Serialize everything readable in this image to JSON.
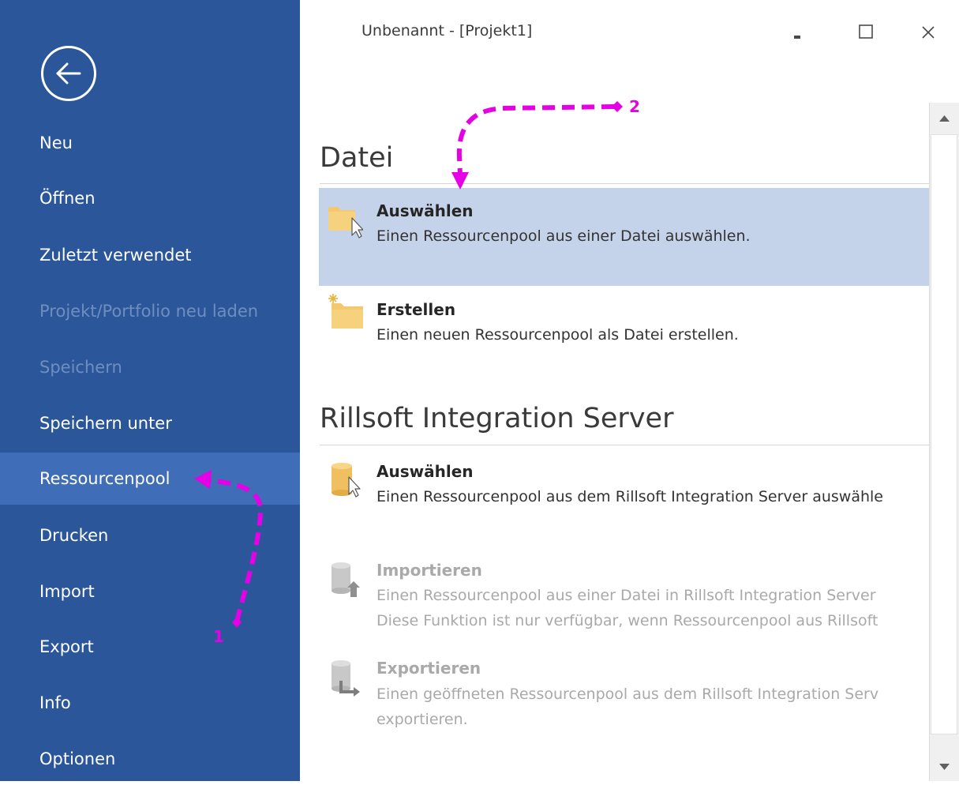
{
  "window": {
    "title": "Unbenannt - [Projekt1]",
    "controls": [
      "minimize",
      "maximize",
      "close"
    ]
  },
  "sidebar": {
    "back_icon": "back-arrow-icon",
    "items": [
      {
        "label": "Neu",
        "state": "enabled"
      },
      {
        "label": "Öffnen",
        "state": "enabled"
      },
      {
        "label": "Zuletzt verwendet",
        "state": "enabled"
      },
      {
        "label": "Projekt/Portfolio neu laden",
        "state": "disabled"
      },
      {
        "label": "Speichern",
        "state": "disabled"
      },
      {
        "label": "Speichern unter",
        "state": "enabled"
      },
      {
        "label": "Ressourcenpool",
        "state": "active"
      },
      {
        "label": "Drucken",
        "state": "enabled"
      },
      {
        "label": "Import",
        "state": "enabled"
      },
      {
        "label": "Export",
        "state": "enabled"
      },
      {
        "label": "Info",
        "state": "enabled"
      },
      {
        "label": "Optionen",
        "state": "enabled"
      }
    ]
  },
  "content": {
    "sections": [
      {
        "heading": "Datei",
        "options": [
          {
            "title": "Auswählen",
            "desc": [
              "Einen Ressourcenpool aus einer Datei auswählen."
            ],
            "icon": "folder-select-icon",
            "state": "selected"
          },
          {
            "title": "Erstellen",
            "desc": [
              "Einen neuen Ressourcenpool als Datei erstellen."
            ],
            "icon": "folder-new-icon",
            "state": "enabled"
          }
        ]
      },
      {
        "heading": "Rillsoft Integration Server",
        "options": [
          {
            "title": "Auswählen",
            "desc": [
              "Einen Ressourcenpool aus dem Rillsoft Integration Server auswähle"
            ],
            "icon": "database-select-icon",
            "state": "enabled"
          },
          {
            "title": "Importieren",
            "desc": [
              "Einen Ressourcenpool aus einer Datei in Rillsoft Integration Server",
              "Diese Funktion ist nur verfügbar, wenn Ressourcenpool aus Rillsoft"
            ],
            "icon": "database-import-icon",
            "state": "disabled"
          },
          {
            "title": "Exportieren",
            "desc": [
              "Einen geöffneten Ressourcenpool aus dem Rillsoft Integration Serv",
              "exportieren."
            ],
            "icon": "database-export-icon",
            "state": "disabled"
          }
        ]
      }
    ]
  },
  "annotations": {
    "label_1": "1",
    "label_2": "2",
    "color": "#e600e6"
  },
  "colors": {
    "sidebar_bg": "#2b579a",
    "sidebar_active": "#3f6db7",
    "selected_option": "#c5d3ea",
    "folder": "#f3c86e",
    "database": "#f0c060"
  }
}
